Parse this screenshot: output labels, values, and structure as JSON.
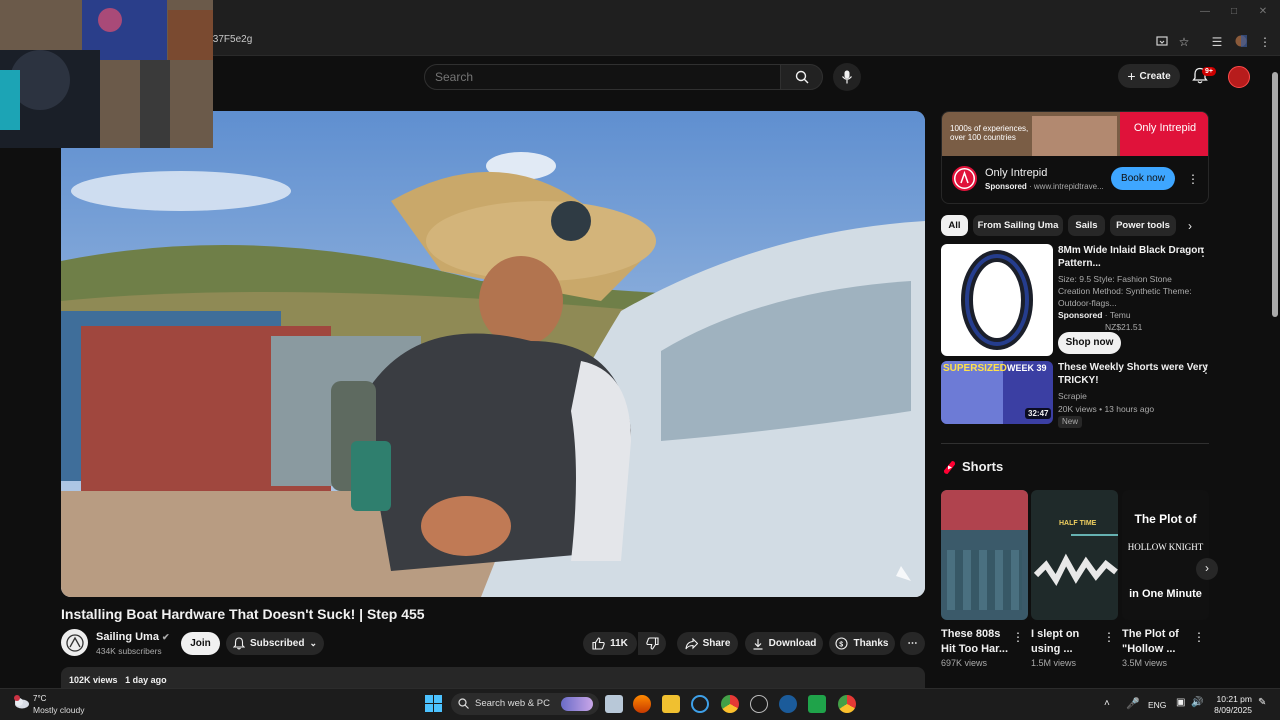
{
  "browser": {
    "url": "t37F5e2g"
  },
  "header": {
    "search_placeholder": "Search",
    "create_label": "Create",
    "notifications_badge": "9+"
  },
  "video": {
    "title": "Installing Boat Hardware That Doesn't Suck! | Step 455",
    "channel_name": "Sailing Uma",
    "subscribers": "434K subscribers",
    "join_label": "Join",
    "subscribed_label": "Subscribed",
    "likes": "11K",
    "share_label": "Share",
    "download_label": "Download",
    "thanks_label": "Thanks",
    "views": "102K views",
    "posted": "1 day ago"
  },
  "ad": {
    "banner_left": "1000s of experiences, over 100 countries",
    "banner_right": "Only Intrepid",
    "title": "Only Intrepid",
    "sponsored": "Sponsored",
    "domain": "www.intrepidtrave...",
    "cta": "Book now"
  },
  "chips": [
    "All",
    "From Sailing Uma",
    "Sails",
    "Power tools"
  ],
  "recommendations": {
    "product": {
      "title_line1": "8Mm Wide Inlaid Black Dragon",
      "title_line2": "Pattern...",
      "desc_line1": "Size: 9.5 Style: Fashion Stone",
      "desc_line2": "Creation Method: Synthetic Theme:",
      "desc_line3": "Outdoor-flags...",
      "sponsored": "Sponsored",
      "seller": "Temu",
      "price": "NZ$21.51",
      "cta": "Shop now"
    },
    "video": {
      "title_line1": "These Weekly Shorts were Very",
      "title_line2": "TRICKY!",
      "channel": "Scrapie",
      "meta": "20K views • 13 hours ago",
      "badge": "New",
      "duration": "32:47",
      "thumb_text_left": "SUPERSIZED",
      "thumb_text_right": "WEEK 39"
    }
  },
  "shorts": {
    "heading": "Shorts",
    "items": [
      {
        "title_line1": "These 808s",
        "title_line2": "Hit Too Har...",
        "views": "697K views"
      },
      {
        "title_line1": "I slept on",
        "title_line2": "using ...",
        "views": "1.5M views",
        "thumb_text": "HALF TIME"
      },
      {
        "title_line1": "The Plot of",
        "title_line2": "\"Hollow ...",
        "views": "3.5M views",
        "thumb_text_1": "The Plot of",
        "thumb_text_2": "HOLLOW KNIGHT",
        "thumb_text_3": "in One Minute"
      }
    ]
  },
  "taskbar": {
    "temp": "7°C",
    "weather": "Mostly cloudy",
    "search_label": "Search web & PC",
    "lang": "ENG",
    "time": "10:21 pm",
    "date": "8/09/2025"
  }
}
